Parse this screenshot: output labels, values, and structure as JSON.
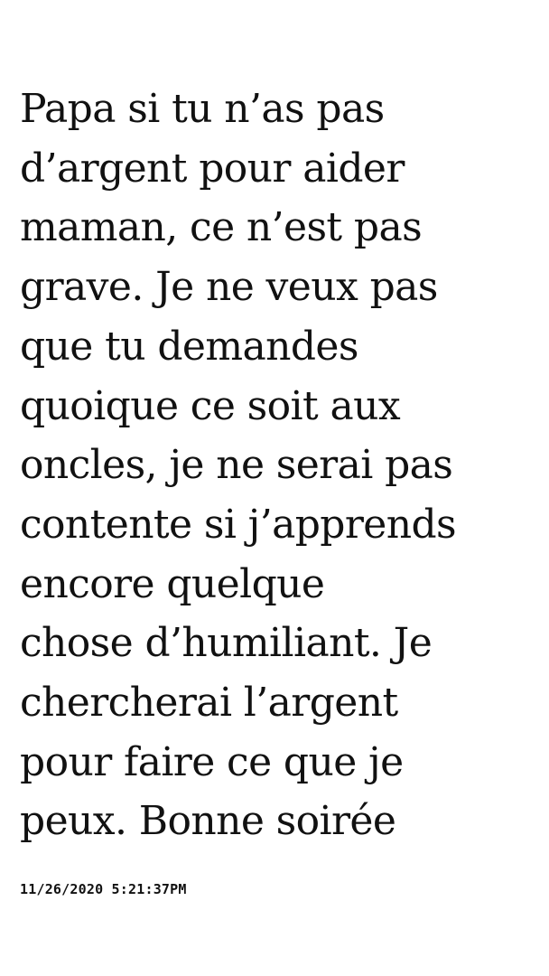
{
  "message": {
    "lines": [
      "Papa si tu n’as pas",
      "d’argent pour aider",
      "maman, ce n’est pas",
      "grave. Je ne veux pas",
      "que tu demandes",
      "quoique ce soit aux",
      "oncles, je ne serai pas",
      "contente si j’apprends",
      "encore quelque",
      "chose d’humiliant. Je",
      "chercherai l’argent",
      "pour faire ce que je",
      "peux. Bonne soirée"
    ]
  },
  "timestamp": "11/26/2020 5:21:37PM",
  "colors": {
    "background": "#ffffff",
    "text": "#111111"
  }
}
